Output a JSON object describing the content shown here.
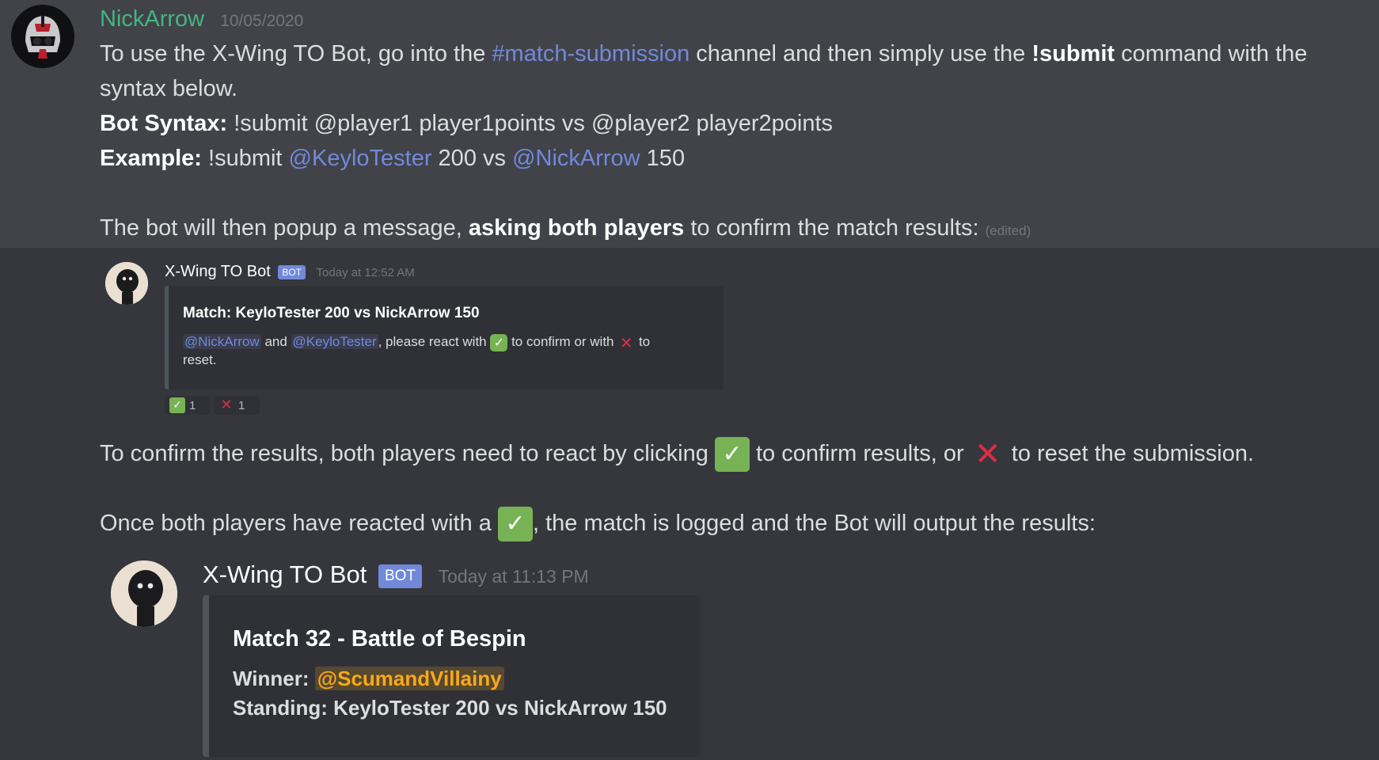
{
  "main_message": {
    "author": "NickArrow",
    "timestamp": "10/05/2020",
    "line1_a": "To use the X-Wing TO Bot, go into the ",
    "line1_channel": "#match-submission",
    "line1_b": " channel and then simply use the ",
    "line1_cmd": "!submit",
    "line1_c": " command with the",
    "line2": "syntax below.",
    "syntax_label": "Bot Syntax:",
    "syntax_text": " !submit @player1 player1points vs @player2 player2points",
    "example_label": "Example:",
    "example_a": " !submit ",
    "example_mention1": "@KeyloTester",
    "example_b": " 200 vs ",
    "example_mention2": "@NickArrow",
    "example_c": " 150",
    "popup_a": "The bot will then popup a message, ",
    "popup_bold": "asking both players",
    "popup_b": " to confirm the match results: ",
    "edited": "(edited)",
    "confirm_a": "To confirm the results, both players need to react by clicking ",
    "confirm_b": " to confirm results, or ",
    "confirm_c": " to reset the submission.",
    "logged_a": "Once both players have reacted with a ",
    "logged_b": ", the match is logged and the Bot will output the results:"
  },
  "bot_message_1": {
    "author": "X-Wing TO Bot",
    "tag": "BOT",
    "timestamp": "Today at 12:52 AM",
    "embed_title": "Match: KeyloTester 200 vs NickArrow 150",
    "mention1": "@NickArrow",
    "and_text": " and ",
    "mention2": "@KeyloTester",
    "react_a": ", please react with ",
    "react_b": " to confirm or with ",
    "react_c": " to",
    "react_d": "reset.",
    "reactions": [
      {
        "emoji": "check-mark",
        "count": "1"
      },
      {
        "emoji": "cross-mark",
        "count": "1"
      }
    ]
  },
  "bot_message_2": {
    "author": "X-Wing TO Bot",
    "tag": "BOT",
    "timestamp": "Today at 11:13 PM",
    "embed_title": "Match 32 - Battle of Bespin",
    "winner_label": "Winner: ",
    "winner_mention": "@ScumandVillainy",
    "standing": "Standing: KeyloTester 200 vs NickArrow 150"
  },
  "glyphs": {
    "check": "✓",
    "cross": "✕"
  },
  "colors": {
    "background": "#36393f",
    "hover_background": "#414349",
    "author_green": "#43b581",
    "mention_blue": "#7289da",
    "embed_bg": "#2f3136",
    "check_green": "#77b255",
    "cross_red": "#dd2e44",
    "winner_gold": "#faa81a"
  }
}
